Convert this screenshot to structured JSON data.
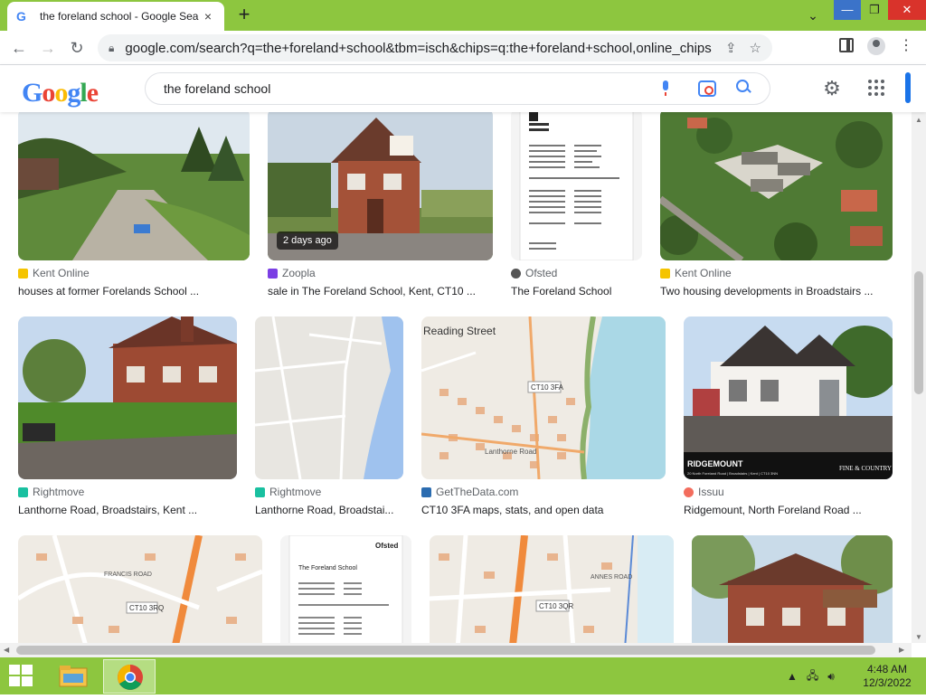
{
  "browser": {
    "tab_title": "the foreland school - Google Sea",
    "tab_close": "×",
    "new_tab": "+",
    "tab_search": "⌄",
    "url": "google.com/search?q=the+foreland+school&tbm=isch&chips=q:the+foreland+school,online_chips:lanthorne+r...",
    "window": {
      "minimize": "—",
      "maximize": "❐",
      "close": "✕"
    }
  },
  "google": {
    "logo_letters": [
      "G",
      "o",
      "o",
      "g",
      "l",
      "e"
    ],
    "search_value": "the foreland school",
    "settings_glyph": "⚙"
  },
  "results": [
    {
      "source": "Kent Online",
      "caption": "houses at former Forelands School ...",
      "favicon_color": "#f5c400"
    },
    {
      "source": "Zoopla",
      "caption": "sale in The Foreland School, Kent, CT10 ...",
      "badge": "2 days ago",
      "favicon_color": "#7b3fe4"
    },
    {
      "source": "Ofsted",
      "caption": "The Foreland School",
      "favicon_color": "#555555"
    },
    {
      "source": "Kent Online",
      "caption": "Two housing developments in Broadstairs ...",
      "favicon_color": "#f5c400"
    },
    {
      "source": "Rightmove",
      "caption": "Lanthorne Road, Broadstairs, Kent ...",
      "favicon_color": "#19c0a0"
    },
    {
      "source": "Rightmove",
      "caption": "Lanthorne Road, Broadstai...",
      "favicon_color": "#19c0a0"
    },
    {
      "source": "GetTheData.com",
      "caption": "CT10 3FA maps, stats, and open data",
      "favicon_color": "#2b6cb0"
    },
    {
      "source": "Issuu",
      "caption": "Ridgemount, North Foreland Road ...",
      "favicon_color": "#f36d5d"
    }
  ],
  "image_texts": {
    "map1_street": "Reading Street",
    "map1_road": "Lanthorne Road",
    "map1_postcode": "CT10 3FA",
    "ridgemount_title": "RIDGEMOUNT",
    "ridgemount_sub": "20 North Foreland Road | Broadstairs | Kent | CT10 3NN",
    "fine_country": "FINE & COUNTRY",
    "map2_close": "CT10 3RQ",
    "map2_street": "FRANCIS ROAD",
    "doc_title": "The Foreland School",
    "ofsted_logo": "Ofsted",
    "map3_postcode": "CT10 3QR",
    "map3_road": "ANNES ROAD"
  },
  "taskbar": {
    "time": "4:48 AM",
    "date": "12/3/2022"
  }
}
